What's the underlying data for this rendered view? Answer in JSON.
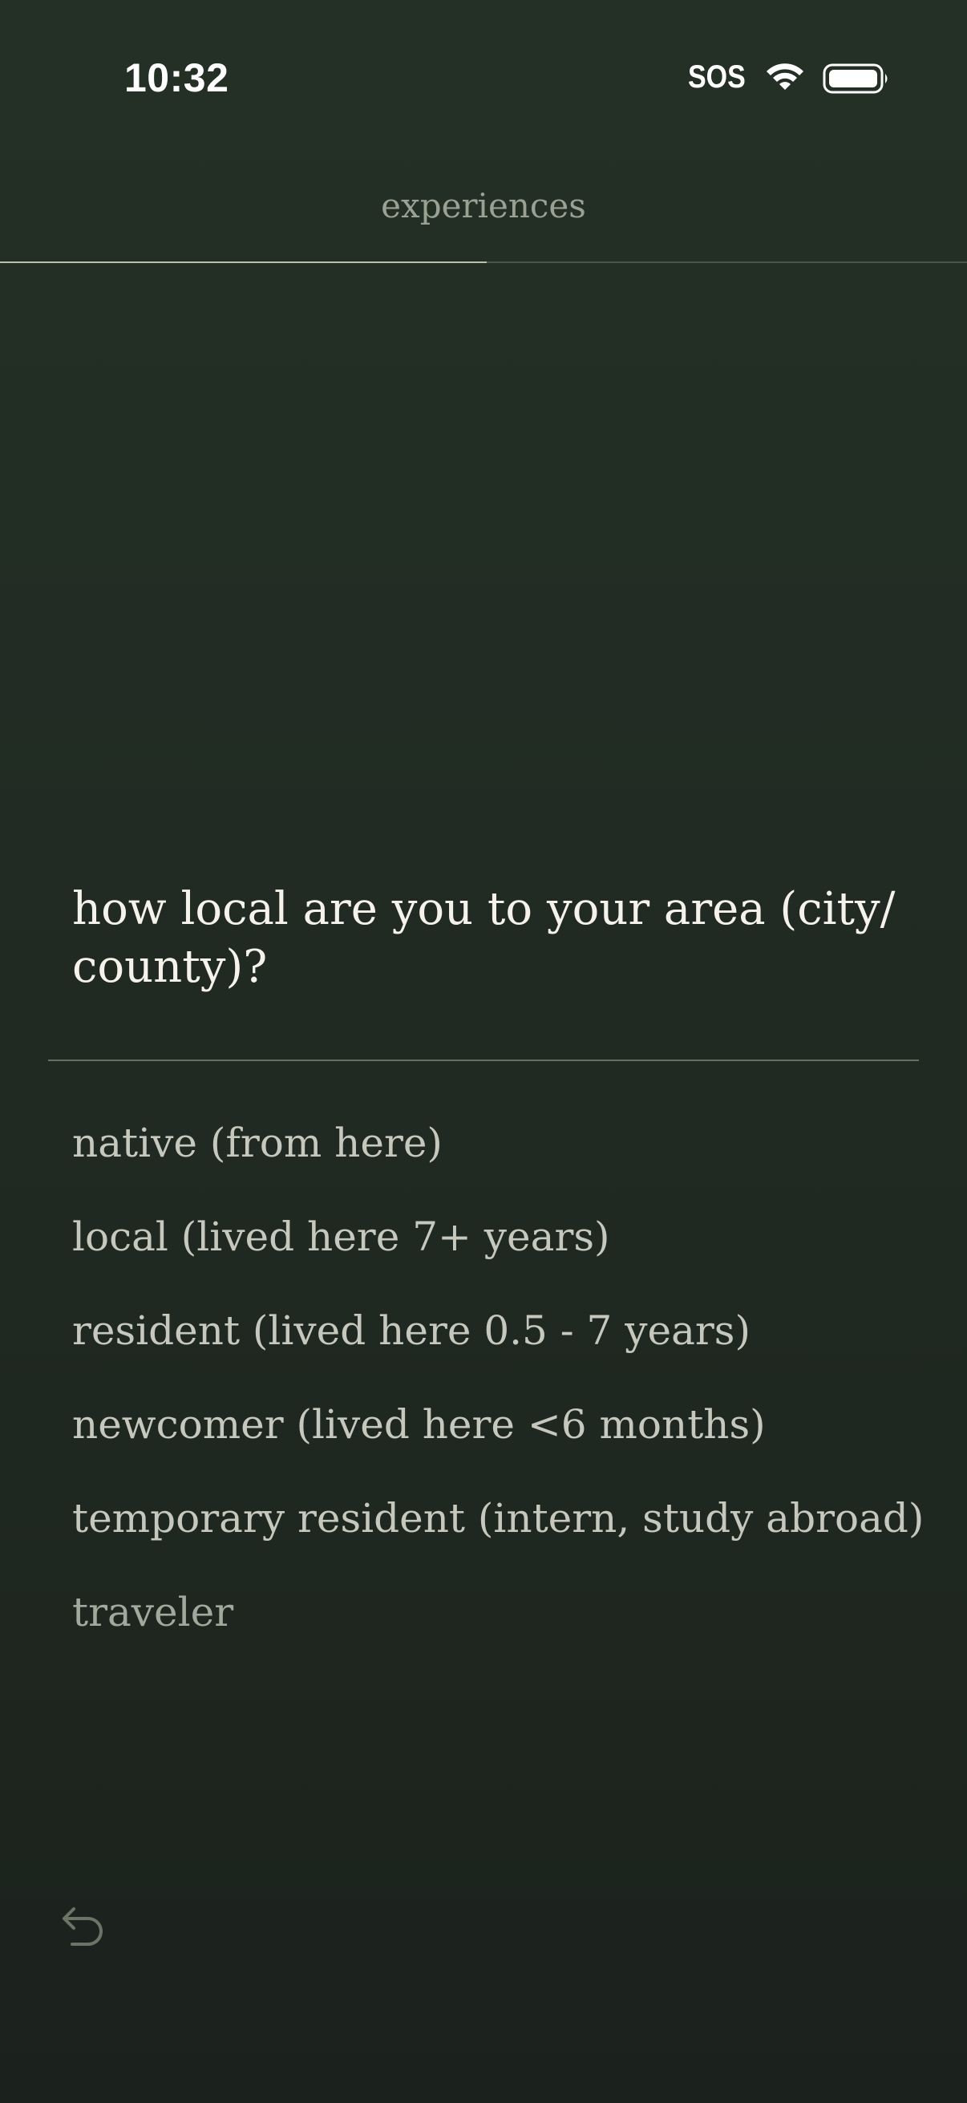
{
  "status_bar": {
    "time": "10:32",
    "sos": "SOS",
    "wifi_icon": "wifi-icon",
    "battery_icon": "battery-icon"
  },
  "header": {
    "title": "experiences",
    "progress": 0.503
  },
  "question": {
    "text": "how local are you to your area (city/ county)?"
  },
  "options": [
    {
      "label": "native (from here)"
    },
    {
      "label": "local (lived here 7+ years)"
    },
    {
      "label": "resident (lived here 0.5 - 7 years)"
    },
    {
      "label": "newcomer (lived here <6 months)"
    },
    {
      "label": "temporary resident (intern, study abroad)"
    },
    {
      "label": "traveler"
    }
  ],
  "footer": {
    "back_icon": "back-arrow-icon"
  },
  "colors": {
    "background_top": "#243026",
    "background_bottom": "#1b211d",
    "text_primary": "#f4f2ea",
    "text_option": "#c6c8bd",
    "text_muted": "#9aa193"
  }
}
